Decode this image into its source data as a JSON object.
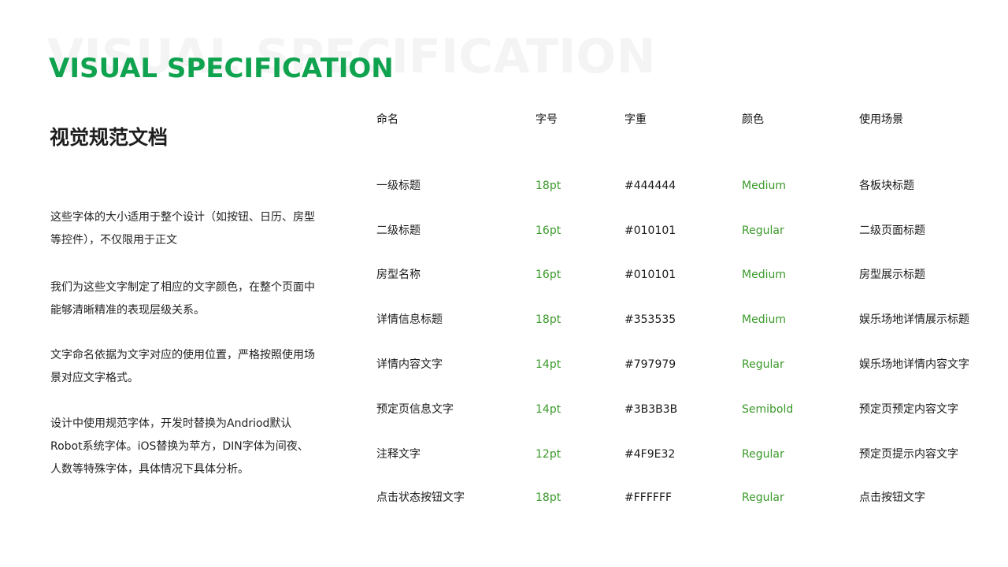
{
  "background_word": "VISUAL SPECIFICATION",
  "title": "VISUAL SPECIFICATION",
  "subtitle": "视觉规范文档",
  "paragraphs": [
    "这些字体的大小适用于整个设计（如按钮、日历、房型等控件），不仅限用于正文",
    "我们为这些文字制定了相应的文字颜色，在整个页面中能够清晰精准的表现层级关系。",
    "文字命名依据为文字对应的使用位置，严格按照使用场景对应文字格式。",
    "设计中使用规范字体，开发时替换为Andriod默认Robot系统字体。iOS替换为苹方，DIN字体为间夜、人数等特殊字体，具体情况下具体分析。"
  ],
  "table": {
    "headers": {
      "name": "命名",
      "size": "字号",
      "weight": "字重",
      "color": "颜色",
      "usage": "使用场景"
    },
    "rows": [
      {
        "name": "一级标题",
        "size": "18pt",
        "weight": "#444444",
        "color": "Medium",
        "usage": "各板块标题"
      },
      {
        "name": "二级标题",
        "size": "16pt",
        "weight": "#010101",
        "color": "Regular",
        "usage": "二级页面标题"
      },
      {
        "name": "房型名称",
        "size": "16pt",
        "weight": "#010101",
        "color": "Medium",
        "usage": "房型展示标题"
      },
      {
        "name": "详情信息标题",
        "size": "18pt",
        "weight": "#353535",
        "color": "Medium",
        "usage": "娱乐场地详情展示标题"
      },
      {
        "name": "详情内容文字",
        "size": "14pt",
        "weight": "#797979",
        "color": "Regular",
        "usage": "娱乐场地详情内容文字"
      },
      {
        "name": "预定页信息文字",
        "size": "14pt",
        "weight": "#3B3B3B",
        "color": "Semibold",
        "usage": "预定页预定内容文字"
      },
      {
        "name": "注释文字",
        "size": "12pt",
        "weight": "#4F9E32",
        "color": "Regular",
        "usage": "预定页提示内容文字"
      },
      {
        "name": "点击状态按钮文字",
        "size": "18pt",
        "weight": "#FFFFFF",
        "color": "Regular",
        "usage": "点击按钮文字"
      }
    ]
  },
  "colors": {
    "title_green": "#0fa34f",
    "value_green": "#3a9a2a",
    "watermark": "#f4f4f4"
  }
}
